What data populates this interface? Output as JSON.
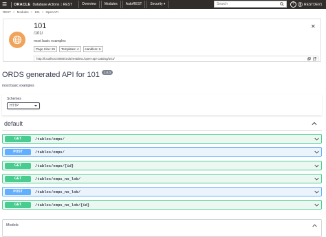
{
  "topbar": {
    "brand_oracle": "ORACLE",
    "brand_app": "Database Actions",
    "brand_section": "REST",
    "nav": [
      "Overview",
      "Modules",
      "AutoREST",
      "Security"
    ],
    "search_placeholder": "Search",
    "user": "RESTDEV1"
  },
  "breadcrumb": [
    "REST",
    "Modules",
    "101",
    "OpenAPI"
  ],
  "card": {
    "title": "101",
    "path": "/101/",
    "description": "most basic examples",
    "pills": [
      "Page Size: 25",
      "Templates: 4",
      "Handlers: 6"
    ],
    "url": "http://localhost:8080/ords/restdev1/open-api-catalog/101/"
  },
  "api": {
    "title": "ORDS generated API for 101",
    "version": "1.0.0",
    "description": "most basic examples"
  },
  "schemes": {
    "label": "Schemes",
    "selected": "HTTP"
  },
  "tag": {
    "label": "default"
  },
  "operations": [
    {
      "method": "GET",
      "path": "/tables/emps/"
    },
    {
      "method": "POST",
      "path": "/tables/emps/"
    },
    {
      "method": "GET",
      "path": "/tables/emps/{id}"
    },
    {
      "method": "GET",
      "path": "/tables/emps_no_lob/"
    },
    {
      "method": "POST",
      "path": "/tables/emps_no_lob/"
    },
    {
      "method": "GET",
      "path": "/tables/emps_no_lob/{id}"
    }
  ],
  "models": {
    "label": "Models"
  },
  "colors": {
    "get_badge": "#49cc90",
    "post_badge": "#61affe",
    "globe": "#f0a35a",
    "topbar": "#312d2a"
  }
}
